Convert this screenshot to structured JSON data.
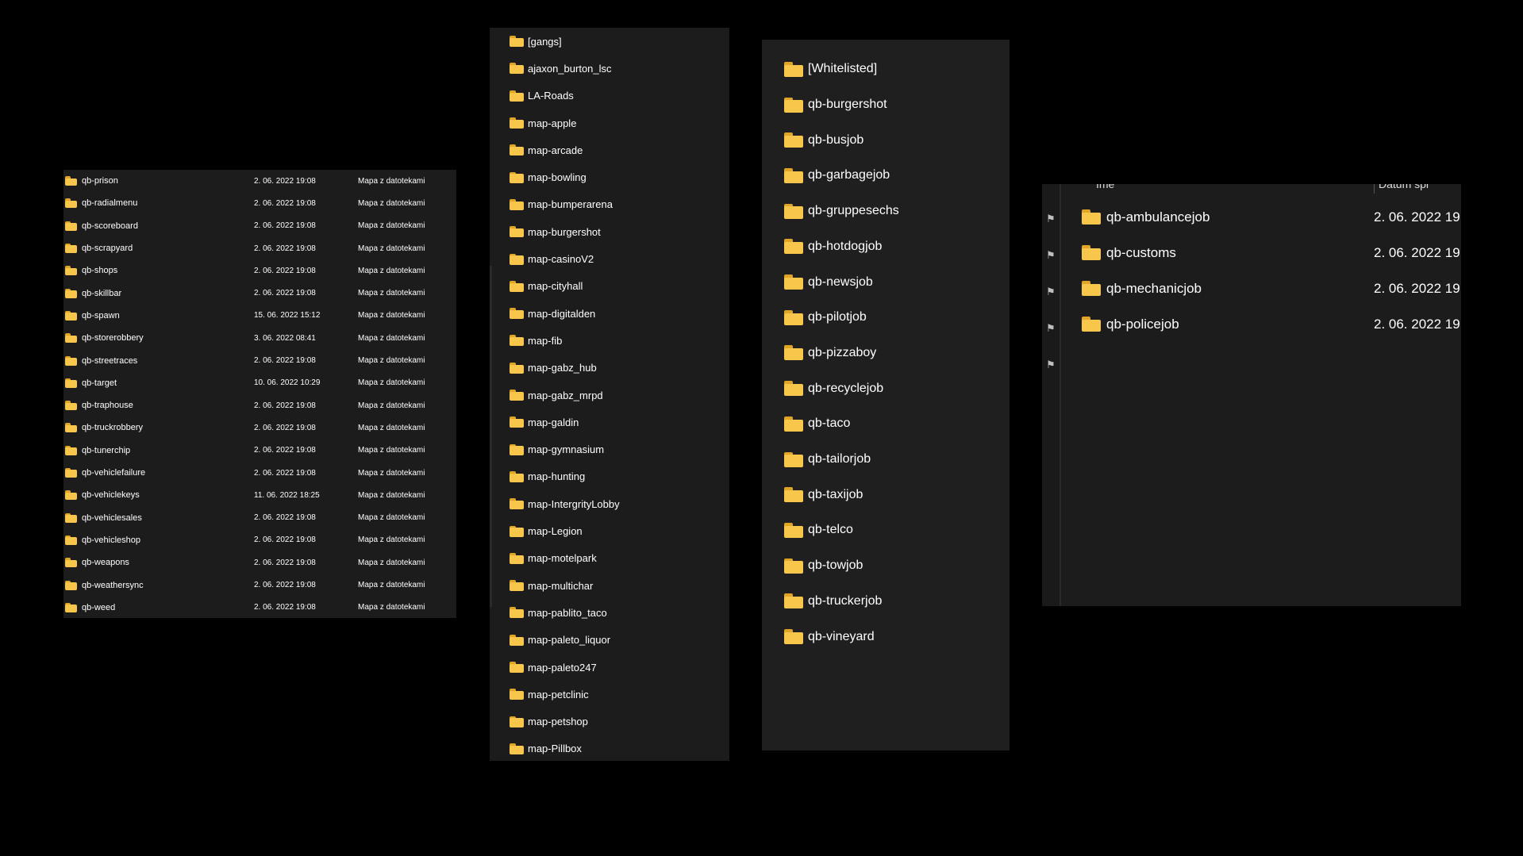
{
  "panel1": {
    "type_label": "Mapa z datotekami",
    "items": [
      {
        "name": "qb-prison",
        "date": "2. 06. 2022 19:08"
      },
      {
        "name": "qb-radialmenu",
        "date": "2. 06. 2022 19:08"
      },
      {
        "name": "qb-scoreboard",
        "date": "2. 06. 2022 19:08"
      },
      {
        "name": "qb-scrapyard",
        "date": "2. 06. 2022 19:08"
      },
      {
        "name": "qb-shops",
        "date": "2. 06. 2022 19:08"
      },
      {
        "name": "qb-skillbar",
        "date": "2. 06. 2022 19:08"
      },
      {
        "name": "qb-spawn",
        "date": "15. 06. 2022 15:12"
      },
      {
        "name": "qb-storerobbery",
        "date": "3. 06. 2022 08:41"
      },
      {
        "name": "qb-streetraces",
        "date": "2. 06. 2022 19:08"
      },
      {
        "name": "qb-target",
        "date": "10. 06. 2022 10:29"
      },
      {
        "name": "qb-traphouse",
        "date": "2. 06. 2022 19:08"
      },
      {
        "name": "qb-truckrobbery",
        "date": "2. 06. 2022 19:08"
      },
      {
        "name": "qb-tunerchip",
        "date": "2. 06. 2022 19:08"
      },
      {
        "name": "qb-vehiclefailure",
        "date": "2. 06. 2022 19:08"
      },
      {
        "name": "qb-vehiclekeys",
        "date": "11. 06. 2022 18:25"
      },
      {
        "name": "qb-vehiclesales",
        "date": "2. 06. 2022 19:08"
      },
      {
        "name": "qb-vehicleshop",
        "date": "2. 06. 2022 19:08"
      },
      {
        "name": "qb-weapons",
        "date": "2. 06. 2022 19:08"
      },
      {
        "name": "qb-weathersync",
        "date": "2. 06. 2022 19:08"
      },
      {
        "name": "qb-weed",
        "date": "2. 06. 2022 19:08"
      }
    ]
  },
  "panel2": {
    "items": [
      "[gangs]",
      "ajaxon_burton_lsc",
      "LA-Roads",
      "map-apple",
      "map-arcade",
      "map-bowling",
      "map-bumperarena",
      "map-burgershot",
      "map-casinoV2",
      "map-cityhall",
      "map-digitalden",
      "map-fib",
      "map-gabz_hub",
      "map-gabz_mrpd",
      "map-galdin",
      "map-gymnasium",
      "map-hunting",
      "map-IntergrityLobby",
      "map-Legion",
      "map-motelpark",
      "map-multichar",
      "map-pablito_taco",
      "map-paleto_liquor",
      "map-paleto247",
      "map-petclinic",
      "map-petshop",
      "map-Pillbox"
    ]
  },
  "panel3": {
    "items": [
      "[Whitelisted]",
      "qb-burgershot",
      "qb-busjob",
      "qb-garbagejob",
      "qb-gruppesechs",
      "qb-hotdogjob",
      "qb-newsjob",
      "qb-pilotjob",
      "qb-pizzaboy",
      "qb-recyclejob",
      "qb-taco",
      "qb-tailorjob",
      "qb-taxijob",
      "qb-telco",
      "qb-towjob",
      "qb-truckerjob",
      "qb-vineyard"
    ]
  },
  "panel4": {
    "header_name": "Ime",
    "header_date": "Datum spr",
    "items": [
      {
        "name": "qb-ambulancejob",
        "date": "2. 06. 2022 19"
      },
      {
        "name": "qb-customs",
        "date": "2. 06. 2022 19"
      },
      {
        "name": "qb-mechanicjob",
        "date": "2. 06. 2022 19"
      },
      {
        "name": "qb-policejob",
        "date": "2. 06. 2022 19"
      }
    ]
  },
  "icons": {
    "folder": "folder-icon",
    "pin": "pin-icon"
  },
  "colors": {
    "background": "#000000",
    "panel": "#1c1c1c",
    "folder": "#f8c64a"
  }
}
